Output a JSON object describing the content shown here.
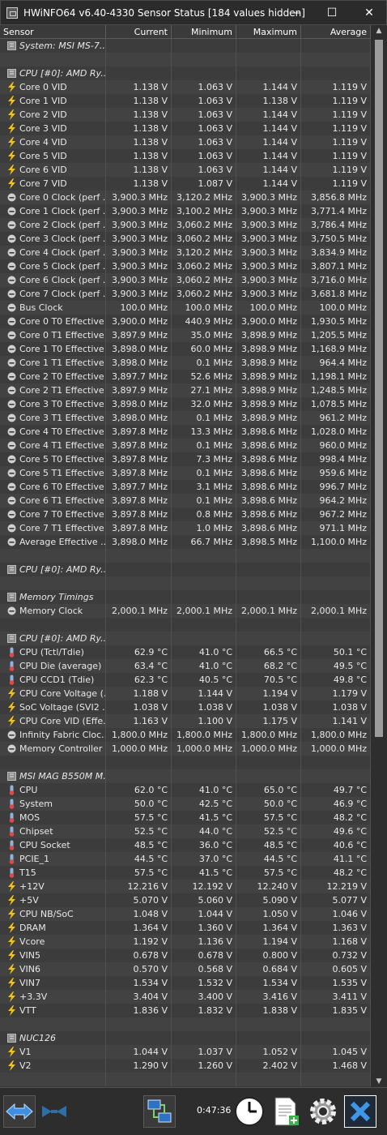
{
  "window": {
    "title": "HWiNFO64 v6.40-4330 Sensor Status [184 values hidden]",
    "minimize_glyph": "—",
    "maximize_glyph": "☐",
    "close_glyph": "✕"
  },
  "columns": [
    "Sensor",
    "Current",
    "Minimum",
    "Maximum",
    "Average"
  ],
  "icon_colors": {
    "volt": "#f2c21b",
    "clock": "#d0d0d0",
    "temp": "#8fb3dc",
    "temp_bulb": "#e24848"
  },
  "rows": [
    {
      "type": "group",
      "icon": "sensor-chip-icon",
      "label": "System: MSI MS-7..."
    },
    {
      "type": "blank"
    },
    {
      "type": "group",
      "icon": "sensor-chip-icon",
      "label": "CPU [#0]: AMD Ry..."
    },
    {
      "type": "data",
      "icon": "voltage-icon",
      "label": "Core 0 VID",
      "current": "1.138 V",
      "min": "1.063 V",
      "max": "1.144 V",
      "avg": "1.119 V"
    },
    {
      "type": "data",
      "icon": "voltage-icon",
      "label": "Core 1 VID",
      "current": "1.138 V",
      "min": "1.063 V",
      "max": "1.138 V",
      "avg": "1.119 V"
    },
    {
      "type": "data",
      "icon": "voltage-icon",
      "label": "Core 2 VID",
      "current": "1.138 V",
      "min": "1.063 V",
      "max": "1.144 V",
      "avg": "1.119 V"
    },
    {
      "type": "data",
      "icon": "voltage-icon",
      "label": "Core 3 VID",
      "current": "1.138 V",
      "min": "1.063 V",
      "max": "1.144 V",
      "avg": "1.119 V"
    },
    {
      "type": "data",
      "icon": "voltage-icon",
      "label": "Core 4 VID",
      "current": "1.138 V",
      "min": "1.063 V",
      "max": "1.144 V",
      "avg": "1.119 V"
    },
    {
      "type": "data",
      "icon": "voltage-icon",
      "label": "Core 5 VID",
      "current": "1.138 V",
      "min": "1.063 V",
      "max": "1.144 V",
      "avg": "1.119 V"
    },
    {
      "type": "data",
      "icon": "voltage-icon",
      "label": "Core 6 VID",
      "current": "1.138 V",
      "min": "1.063 V",
      "max": "1.144 V",
      "avg": "1.119 V"
    },
    {
      "type": "data",
      "icon": "voltage-icon",
      "label": "Core 7 VID",
      "current": "1.138 V",
      "min": "1.087 V",
      "max": "1.144 V",
      "avg": "1.119 V"
    },
    {
      "type": "data",
      "icon": "clock-icon",
      "label": "Core 0 Clock (perf ...",
      "current": "3,900.3 MHz",
      "min": "3,120.2 MHz",
      "max": "3,900.3 MHz",
      "avg": "3,856.8 MHz"
    },
    {
      "type": "data",
      "icon": "clock-icon",
      "label": "Core 1 Clock (perf ...",
      "current": "3,900.3 MHz",
      "min": "3,100.2 MHz",
      "max": "3,900.3 MHz",
      "avg": "3,771.4 MHz"
    },
    {
      "type": "data",
      "icon": "clock-icon",
      "label": "Core 2 Clock (perf ...",
      "current": "3,900.3 MHz",
      "min": "3,060.2 MHz",
      "max": "3,900.3 MHz",
      "avg": "3,786.4 MHz"
    },
    {
      "type": "data",
      "icon": "clock-icon",
      "label": "Core 3 Clock (perf ...",
      "current": "3,900.3 MHz",
      "min": "3,060.2 MHz",
      "max": "3,900.3 MHz",
      "avg": "3,750.5 MHz"
    },
    {
      "type": "data",
      "icon": "clock-icon",
      "label": "Core 4 Clock (perf ...",
      "current": "3,900.3 MHz",
      "min": "3,120.2 MHz",
      "max": "3,900.3 MHz",
      "avg": "3,834.9 MHz"
    },
    {
      "type": "data",
      "icon": "clock-icon",
      "label": "Core 5 Clock (perf ...",
      "current": "3,900.3 MHz",
      "min": "3,060.2 MHz",
      "max": "3,900.3 MHz",
      "avg": "3,807.1 MHz"
    },
    {
      "type": "data",
      "icon": "clock-icon",
      "label": "Core 6 Clock (perf ...",
      "current": "3,900.3 MHz",
      "min": "3,060.2 MHz",
      "max": "3,900.3 MHz",
      "avg": "3,716.0 MHz"
    },
    {
      "type": "data",
      "icon": "clock-icon",
      "label": "Core 7 Clock (perf ...",
      "current": "3,900.3 MHz",
      "min": "3,060.2 MHz",
      "max": "3,900.3 MHz",
      "avg": "3,681.8 MHz"
    },
    {
      "type": "data",
      "icon": "clock-icon",
      "label": "Bus Clock",
      "current": "100.0 MHz",
      "min": "100.0 MHz",
      "max": "100.0 MHz",
      "avg": "100.0 MHz"
    },
    {
      "type": "data",
      "icon": "clock-icon",
      "label": "Core 0 T0 Effective ...",
      "current": "3,900.0 MHz",
      "min": "440.9 MHz",
      "max": "3,900.0 MHz",
      "avg": "1,930.5 MHz"
    },
    {
      "type": "data",
      "icon": "clock-icon",
      "label": "Core 0 T1 Effective ...",
      "current": "3,897.9 MHz",
      "min": "35.0 MHz",
      "max": "3,898.9 MHz",
      "avg": "1,205.5 MHz"
    },
    {
      "type": "data",
      "icon": "clock-icon",
      "label": "Core 1 T0 Effective ...",
      "current": "3,898.0 MHz",
      "min": "60.0 MHz",
      "max": "3,898.9 MHz",
      "avg": "1,168.9 MHz"
    },
    {
      "type": "data",
      "icon": "clock-icon",
      "label": "Core 1 T1 Effective ...",
      "current": "3,898.0 MHz",
      "min": "0.1 MHz",
      "max": "3,898.9 MHz",
      "avg": "964.4 MHz"
    },
    {
      "type": "data",
      "icon": "clock-icon",
      "label": "Core 2 T0 Effective ...",
      "current": "3,897.7 MHz",
      "min": "52.6 MHz",
      "max": "3,898.9 MHz",
      "avg": "1,198.1 MHz"
    },
    {
      "type": "data",
      "icon": "clock-icon",
      "label": "Core 2 T1 Effective ...",
      "current": "3,897.9 MHz",
      "min": "27.1 MHz",
      "max": "3,898.9 MHz",
      "avg": "1,248.5 MHz"
    },
    {
      "type": "data",
      "icon": "clock-icon",
      "label": "Core 3 T0 Effective ...",
      "current": "3,898.0 MHz",
      "min": "32.0 MHz",
      "max": "3,898.9 MHz",
      "avg": "1,078.5 MHz"
    },
    {
      "type": "data",
      "icon": "clock-icon",
      "label": "Core 3 T1 Effective ...",
      "current": "3,898.0 MHz",
      "min": "0.1 MHz",
      "max": "3,898.9 MHz",
      "avg": "961.2 MHz"
    },
    {
      "type": "data",
      "icon": "clock-icon",
      "label": "Core 4 T0 Effective ...",
      "current": "3,897.8 MHz",
      "min": "13.3 MHz",
      "max": "3,898.6 MHz",
      "avg": "1,028.0 MHz"
    },
    {
      "type": "data",
      "icon": "clock-icon",
      "label": "Core 4 T1 Effective ...",
      "current": "3,897.8 MHz",
      "min": "0.1 MHz",
      "max": "3,898.6 MHz",
      "avg": "960.0 MHz"
    },
    {
      "type": "data",
      "icon": "clock-icon",
      "label": "Core 5 T0 Effective ...",
      "current": "3,897.8 MHz",
      "min": "7.3 MHz",
      "max": "3,898.6 MHz",
      "avg": "998.4 MHz"
    },
    {
      "type": "data",
      "icon": "clock-icon",
      "label": "Core 5 T1 Effective ...",
      "current": "3,897.8 MHz",
      "min": "0.1 MHz",
      "max": "3,898.6 MHz",
      "avg": "959.6 MHz"
    },
    {
      "type": "data",
      "icon": "clock-icon",
      "label": "Core 6 T0 Effective ...",
      "current": "3,897.7 MHz",
      "min": "3.1 MHz",
      "max": "3,898.6 MHz",
      "avg": "996.7 MHz"
    },
    {
      "type": "data",
      "icon": "clock-icon",
      "label": "Core 6 T1 Effective ...",
      "current": "3,897.8 MHz",
      "min": "0.1 MHz",
      "max": "3,898.6 MHz",
      "avg": "964.2 MHz"
    },
    {
      "type": "data",
      "icon": "clock-icon",
      "label": "Core 7 T0 Effective ...",
      "current": "3,897.8 MHz",
      "min": "0.8 MHz",
      "max": "3,898.6 MHz",
      "avg": "967.2 MHz"
    },
    {
      "type": "data",
      "icon": "clock-icon",
      "label": "Core 7 T1 Effective ...",
      "current": "3,897.8 MHz",
      "min": "1.0 MHz",
      "max": "3,898.6 MHz",
      "avg": "971.1 MHz"
    },
    {
      "type": "data",
      "icon": "clock-icon",
      "label": "Average Effective ...",
      "current": "3,898.0 MHz",
      "min": "66.7 MHz",
      "max": "3,898.5 MHz",
      "avg": "1,100.0 MHz"
    },
    {
      "type": "blank"
    },
    {
      "type": "group",
      "icon": "sensor-chip-icon",
      "label": "CPU [#0]: AMD Ry..."
    },
    {
      "type": "blank"
    },
    {
      "type": "group",
      "icon": "sensor-chip-icon",
      "label": "Memory Timings"
    },
    {
      "type": "data",
      "icon": "clock-icon",
      "label": "Memory Clock",
      "current": "2,000.1 MHz",
      "min": "2,000.1 MHz",
      "max": "2,000.1 MHz",
      "avg": "2,000.1 MHz"
    },
    {
      "type": "blank"
    },
    {
      "type": "group",
      "icon": "sensor-chip-icon",
      "label": "CPU [#0]: AMD Ry..."
    },
    {
      "type": "data",
      "icon": "temperature-icon",
      "label": "CPU (Tctl/Tdie)",
      "current": "62.9 °C",
      "min": "41.0 °C",
      "max": "66.5 °C",
      "avg": "50.1 °C"
    },
    {
      "type": "data",
      "icon": "temperature-icon",
      "label": "CPU Die (average)",
      "current": "63.4 °C",
      "min": "41.0 °C",
      "max": "68.2 °C",
      "avg": "49.5 °C"
    },
    {
      "type": "data",
      "icon": "temperature-icon",
      "label": "CPU CCD1 (Tdie)",
      "current": "62.3 °C",
      "min": "40.5 °C",
      "max": "70.5 °C",
      "avg": "49.8 °C"
    },
    {
      "type": "data",
      "icon": "voltage-icon",
      "label": "CPU Core Voltage (...",
      "current": "1.188 V",
      "min": "1.144 V",
      "max": "1.194 V",
      "avg": "1.179 V"
    },
    {
      "type": "data",
      "icon": "voltage-icon",
      "label": "SoC Voltage (SVI2 ...",
      "current": "1.038 V",
      "min": "1.038 V",
      "max": "1.038 V",
      "avg": "1.038 V"
    },
    {
      "type": "data",
      "icon": "voltage-icon",
      "label": "CPU Core VID (Effe...",
      "current": "1.163 V",
      "min": "1.100 V",
      "max": "1.175 V",
      "avg": "1.141 V"
    },
    {
      "type": "data",
      "icon": "clock-icon",
      "label": "Infinity Fabric Cloc...",
      "current": "1,800.0 MHz",
      "min": "1,800.0 MHz",
      "max": "1,800.0 MHz",
      "avg": "1,800.0 MHz"
    },
    {
      "type": "data",
      "icon": "clock-icon",
      "label": "Memory Controller ...",
      "current": "1,000.0 MHz",
      "min": "1,000.0 MHz",
      "max": "1,000.0 MHz",
      "avg": "1,000.0 MHz"
    },
    {
      "type": "blank"
    },
    {
      "type": "group",
      "icon": "sensor-chip-icon",
      "label": "MSI MAG B550M M..."
    },
    {
      "type": "data",
      "icon": "temperature-icon",
      "label": "CPU",
      "current": "62.0 °C",
      "min": "41.0 °C",
      "max": "65.0 °C",
      "avg": "49.7 °C"
    },
    {
      "type": "data",
      "icon": "temperature-icon",
      "label": "System",
      "current": "50.0 °C",
      "min": "42.5 °C",
      "max": "50.0 °C",
      "avg": "46.9 °C"
    },
    {
      "type": "data",
      "icon": "temperature-icon",
      "label": "MOS",
      "current": "57.5 °C",
      "min": "41.5 °C",
      "max": "57.5 °C",
      "avg": "48.2 °C"
    },
    {
      "type": "data",
      "icon": "temperature-icon",
      "label": "Chipset",
      "current": "52.5 °C",
      "min": "44.0 °C",
      "max": "52.5 °C",
      "avg": "49.6 °C"
    },
    {
      "type": "data",
      "icon": "temperature-icon",
      "label": "CPU Socket",
      "current": "48.5 °C",
      "min": "36.0 °C",
      "max": "48.5 °C",
      "avg": "40.6 °C"
    },
    {
      "type": "data",
      "icon": "temperature-icon",
      "label": "PCIE_1",
      "current": "44.5 °C",
      "min": "37.0 °C",
      "max": "44.5 °C",
      "avg": "41.1 °C"
    },
    {
      "type": "data",
      "icon": "temperature-icon",
      "label": "T15",
      "current": "57.5 °C",
      "min": "41.5 °C",
      "max": "57.5 °C",
      "avg": "48.2 °C"
    },
    {
      "type": "data",
      "icon": "voltage-icon",
      "label": "+12V",
      "current": "12.216 V",
      "min": "12.192 V",
      "max": "12.240 V",
      "avg": "12.219 V"
    },
    {
      "type": "data",
      "icon": "voltage-icon",
      "label": "+5V",
      "current": "5.070 V",
      "min": "5.060 V",
      "max": "5.090 V",
      "avg": "5.077 V"
    },
    {
      "type": "data",
      "icon": "voltage-icon",
      "label": "CPU NB/SoC",
      "current": "1.048 V",
      "min": "1.044 V",
      "max": "1.050 V",
      "avg": "1.046 V"
    },
    {
      "type": "data",
      "icon": "voltage-icon",
      "label": "DRAM",
      "current": "1.364 V",
      "min": "1.360 V",
      "max": "1.364 V",
      "avg": "1.363 V"
    },
    {
      "type": "data",
      "icon": "voltage-icon",
      "label": "Vcore",
      "current": "1.192 V",
      "min": "1.136 V",
      "max": "1.194 V",
      "avg": "1.168 V"
    },
    {
      "type": "data",
      "icon": "voltage-icon",
      "label": "VIN5",
      "current": "0.678 V",
      "min": "0.678 V",
      "max": "0.800 V",
      "avg": "0.732 V"
    },
    {
      "type": "data",
      "icon": "voltage-icon",
      "label": "VIN6",
      "current": "0.570 V",
      "min": "0.568 V",
      "max": "0.684 V",
      "avg": "0.605 V"
    },
    {
      "type": "data",
      "icon": "voltage-icon",
      "label": "VIN7",
      "current": "1.534 V",
      "min": "1.532 V",
      "max": "1.534 V",
      "avg": "1.535 V"
    },
    {
      "type": "data",
      "icon": "voltage-icon",
      "label": "+3.3V",
      "current": "3.404 V",
      "min": "3.400 V",
      "max": "3.416 V",
      "avg": "3.411 V"
    },
    {
      "type": "data",
      "icon": "voltage-icon",
      "label": "VTT",
      "current": "1.836 V",
      "min": "1.832 V",
      "max": "1.838 V",
      "avg": "1.835 V"
    },
    {
      "type": "blank"
    },
    {
      "type": "group",
      "icon": "sensor-chip-icon",
      "label": "NUC126"
    },
    {
      "type": "data",
      "icon": "voltage-icon",
      "label": "V1",
      "current": "1.044 V",
      "min": "1.037 V",
      "max": "1.052 V",
      "avg": "1.045 V"
    },
    {
      "type": "data",
      "icon": "voltage-icon",
      "label": "V2",
      "current": "1.290 V",
      "min": "1.260 V",
      "max": "2.402 V",
      "avg": "1.468 V"
    },
    {
      "type": "blank"
    }
  ],
  "footer": {
    "elapsed_time": "0:47:36",
    "buttons": [
      {
        "name": "expand-sensors-button",
        "icon": "double-arrow-icon"
      },
      {
        "name": "collapse-sensors-button",
        "icon": "collapse-arrows-icon"
      },
      {
        "name": "network-button",
        "icon": "network-icon"
      },
      {
        "name": "reset-clock-button",
        "icon": "clock-icon"
      },
      {
        "name": "logging-button",
        "icon": "log-file-icon"
      },
      {
        "name": "settings-button",
        "icon": "gear-icon"
      },
      {
        "name": "close-sensors-button",
        "icon": "close-icon"
      }
    ]
  }
}
